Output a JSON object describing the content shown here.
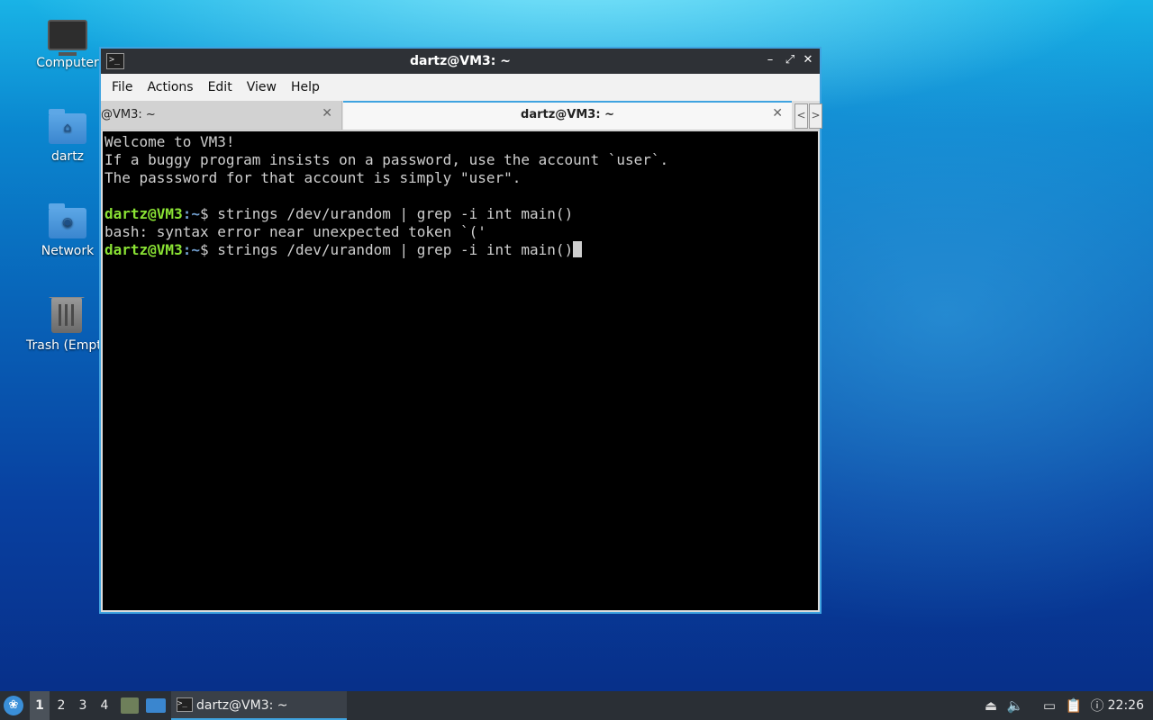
{
  "desktop": {
    "icons": [
      {
        "label": "Computer"
      },
      {
        "label": "dartz"
      },
      {
        "label": "Network"
      },
      {
        "label": "Trash (Empt"
      }
    ]
  },
  "window": {
    "title": "dartz@VM3: ~",
    "controls": {
      "minimize": "–",
      "maximize": "⤢",
      "close": "✕"
    },
    "menu": [
      "File",
      "Actions",
      "Edit",
      "View",
      "Help"
    ],
    "tabs": [
      {
        "label": "@VM3: ~",
        "active": false
      },
      {
        "label": "dartz@VM3: ~",
        "active": true
      }
    ],
    "tab_close": "✕",
    "tab_scroll_left": "<",
    "tab_scroll_right": ">"
  },
  "terminal": {
    "lines": [
      "Welcome to VM3!",
      "If a buggy program insists on a password, use the account `user`.",
      "The passsword for that account is simply \"user\".",
      "",
      "bash: syntax error near unexpected token `('"
    ],
    "prompt_user": "dartz@VM3",
    "prompt_sep": ":",
    "prompt_path": "~",
    "prompt_symbol": "$ ",
    "commands": [
      "strings /dev/urandom | grep -i int main()",
      "strings /dev/urandom | grep -i int main()"
    ]
  },
  "taskbar": {
    "menu_icon": "lubuntu-menu-icon",
    "workspaces": [
      "1",
      "2",
      "3",
      "4"
    ],
    "active_workspace": "1",
    "task_label": "dartz@VM3: ~",
    "clock": "22:26"
  },
  "colors": {
    "accent": "#3fa3e0",
    "prompt_user": "#8ae234",
    "prompt_path": "#729fcf",
    "terminal_bg": "#000000",
    "terminal_fg": "#cfcfcf"
  }
}
